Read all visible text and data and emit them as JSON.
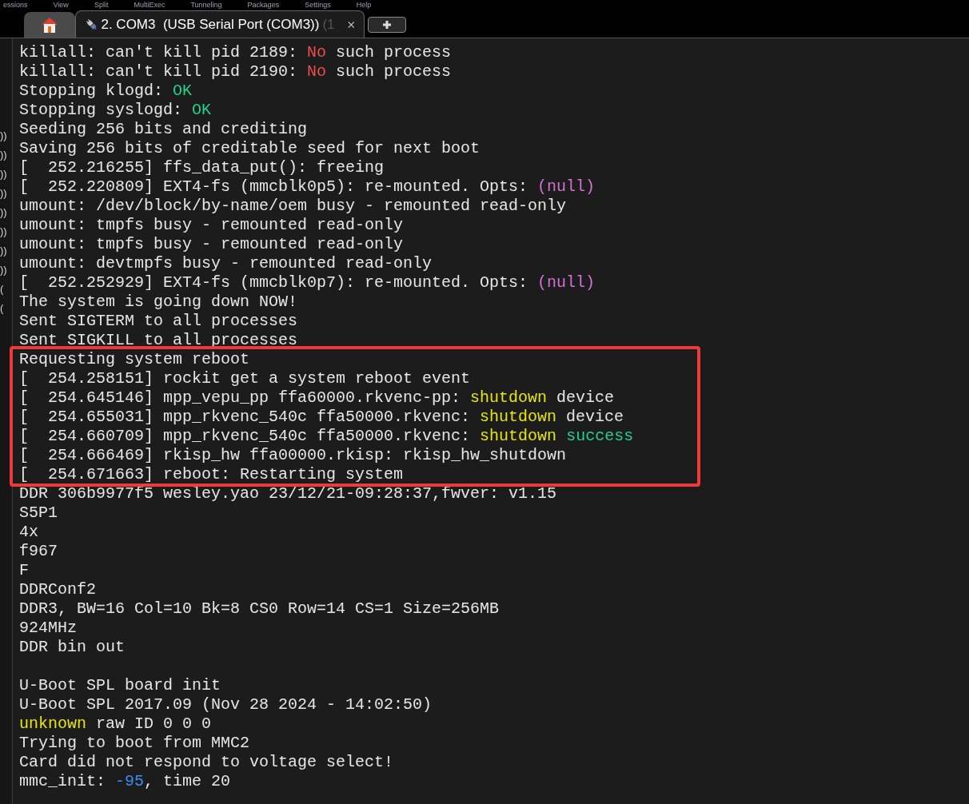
{
  "menu": [
    "essions",
    "View",
    "Split",
    "MultiExec",
    "Tunneling",
    "Packages",
    "Settings",
    "Help"
  ],
  "tabs": [
    {
      "kind": "home",
      "selected": false
    },
    {
      "kind": "session",
      "label": "2. COM3  (USB Serial Port (COM3))",
      "suffix": "(1",
      "selected": true
    }
  ],
  "sidebar": {
    "items": [
      "))",
      "))",
      "))",
      "))",
      "))",
      "))",
      "))",
      "))",
      "(",
      "("
    ]
  },
  "terminal": {
    "lines": [
      {
        "segments": [
          {
            "text": "killall: can't kill pid 2189: "
          },
          {
            "text": "No",
            "color": "#f14c4c"
          },
          {
            "text": " such process"
          }
        ]
      },
      {
        "segments": [
          {
            "text": "killall: can't kill pid 2190: "
          },
          {
            "text": "No",
            "color": "#f14c4c"
          },
          {
            "text": " such process"
          }
        ]
      },
      {
        "segments": [
          {
            "text": "Stopping klogd: "
          },
          {
            "text": "OK",
            "color": "#23d18b"
          }
        ]
      },
      {
        "segments": [
          {
            "text": "Stopping syslogd: "
          },
          {
            "text": "OK",
            "color": "#23d18b"
          }
        ]
      },
      {
        "segments": [
          {
            "text": "Seeding 256 bits and crediting"
          }
        ]
      },
      {
        "segments": [
          {
            "text": "Saving 256 bits of creditable seed for next boot"
          }
        ]
      },
      {
        "segments": [
          {
            "text": "[  252.216255] ffs_data_put(): freeing"
          }
        ]
      },
      {
        "segments": [
          {
            "text": "[  252.220809] EXT4-fs (mmcblk0p5): re-mounted. Opts: "
          },
          {
            "text": "(null)",
            "color": "#d670d6"
          }
        ]
      },
      {
        "segments": [
          {
            "text": "umount: /dev/block/by-name/oem busy - remounted read-only"
          }
        ]
      },
      {
        "segments": [
          {
            "text": "umount: tmpfs busy - remounted read-only"
          }
        ]
      },
      {
        "segments": [
          {
            "text": "umount: tmpfs busy - remounted read-only"
          }
        ]
      },
      {
        "segments": [
          {
            "text": "umount: devtmpfs busy - remounted read-only"
          }
        ]
      },
      {
        "segments": [
          {
            "text": "[  252.252929] EXT4-fs (mmcblk0p7): re-mounted. Opts: "
          },
          {
            "text": "(null)",
            "color": "#d670d6"
          }
        ]
      },
      {
        "segments": [
          {
            "text": "The system is going down NOW!"
          }
        ]
      },
      {
        "segments": [
          {
            "text": "Sent SIGTERM to all processes"
          }
        ]
      },
      {
        "segments": [
          {
            "text": "Sent SIGKILL to all processes"
          }
        ]
      },
      {
        "segments": [
          {
            "text": "Requesting system reboot"
          }
        ]
      },
      {
        "segments": [
          {
            "text": "[  254.258151] rockit get a system reboot event"
          }
        ]
      },
      {
        "segments": [
          {
            "text": "[  254.645146] mpp_vepu_pp ffa60000.rkvenc-pp: "
          },
          {
            "text": "shutdown",
            "color": "#e5e510"
          },
          {
            "text": " device"
          }
        ]
      },
      {
        "segments": [
          {
            "text": "[  254.655031] mpp_rkvenc_540c ffa50000.rkvenc: "
          },
          {
            "text": "shutdown",
            "color": "#e5e510"
          },
          {
            "text": " device"
          }
        ]
      },
      {
        "segments": [
          {
            "text": "[  254.660709] mpp_rkvenc_540c ffa50000.rkvenc: "
          },
          {
            "text": "shutdown ",
            "color": "#e5e510"
          },
          {
            "text": "success",
            "color": "#23d18b"
          }
        ]
      },
      {
        "segments": [
          {
            "text": "[  254.666469] rkisp_hw ffa00000.rkisp: rkisp_hw_shutdown"
          }
        ]
      },
      {
        "segments": [
          {
            "text": "[  254.671663] reboot: Restarting system"
          }
        ]
      },
      {
        "segments": [
          {
            "text": "DDR 306b9977f5 wesley.yao 23/12/21-09:28:37,fwver: v1.15"
          }
        ]
      },
      {
        "segments": [
          {
            "text": "S5P1"
          }
        ]
      },
      {
        "segments": [
          {
            "text": "4x"
          }
        ]
      },
      {
        "segments": [
          {
            "text": "f967"
          }
        ]
      },
      {
        "segments": [
          {
            "text": "F"
          }
        ]
      },
      {
        "segments": [
          {
            "text": "DDRConf2"
          }
        ]
      },
      {
        "segments": [
          {
            "text": "DDR3, BW=16 Col=10 Bk=8 CS0 Row=14 CS=1 Size=256MB"
          }
        ]
      },
      {
        "segments": [
          {
            "text": "924MHz"
          }
        ]
      },
      {
        "segments": [
          {
            "text": "DDR bin out"
          }
        ]
      },
      {
        "kind": "blank"
      },
      {
        "segments": [
          {
            "text": "U-Boot SPL board init"
          }
        ]
      },
      {
        "segments": [
          {
            "text": "U-Boot SPL 2017.09 (Nov 28 2024 - 14:02:50)"
          }
        ]
      },
      {
        "segments": [
          {
            "text": "unknown",
            "color": "#e5e510"
          },
          {
            "text": " raw ID 0 0 0"
          }
        ]
      },
      {
        "segments": [
          {
            "text": "Trying to boot from MMC2"
          }
        ]
      },
      {
        "segments": [
          {
            "text": "Card did not respond to voltage select!"
          }
        ]
      },
      {
        "segments": [
          {
            "text": "mmc_init: "
          },
          {
            "text": "-95",
            "color": "#3b8eea"
          },
          {
            "text": ", time 20"
          }
        ]
      }
    ]
  }
}
